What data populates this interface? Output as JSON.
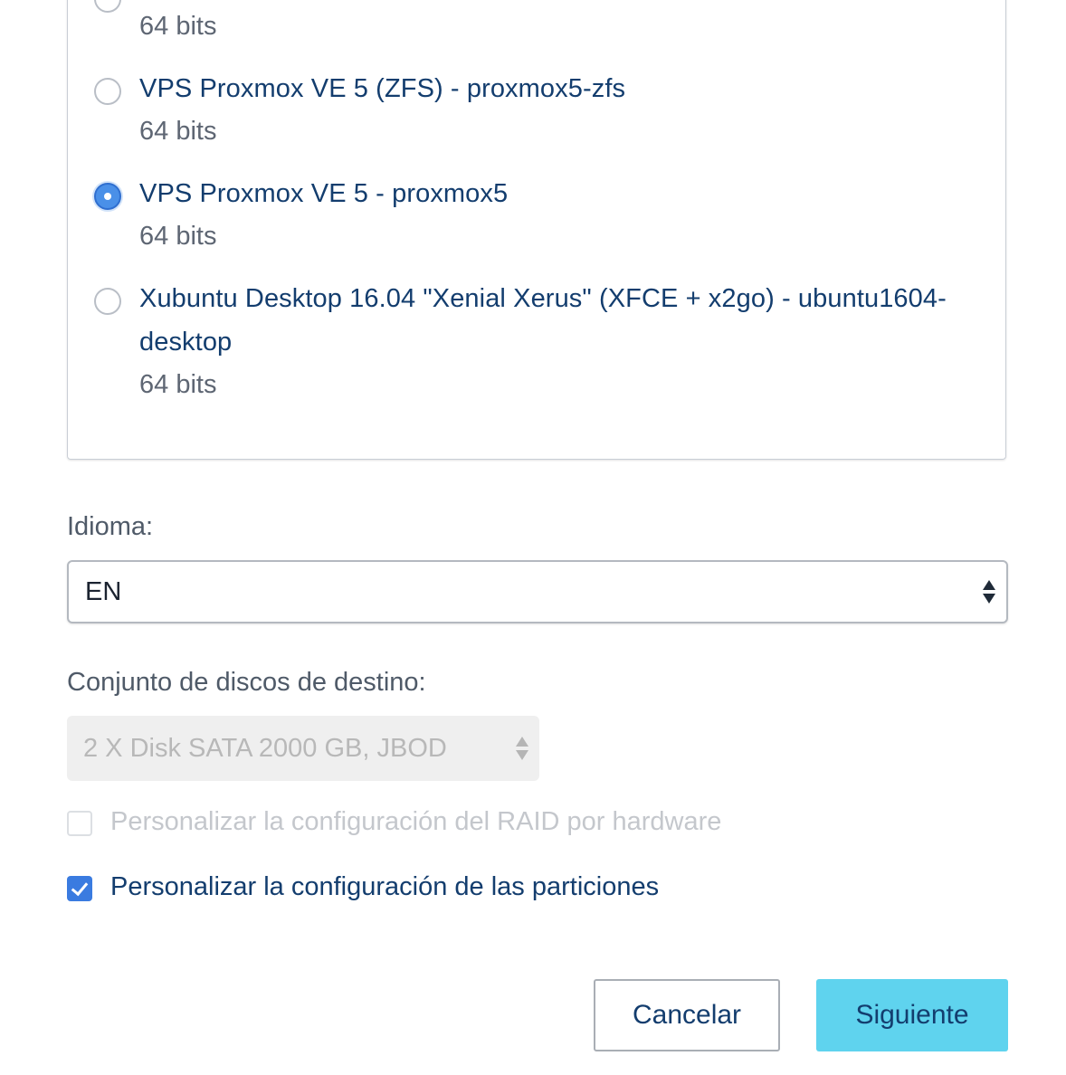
{
  "os_options": [
    {
      "title": "",
      "bits": "64 bits",
      "selected": false
    },
    {
      "title": "VPS Proxmox VE 5 (ZFS) - proxmox5-zfs",
      "bits": "64 bits",
      "selected": false
    },
    {
      "title": "VPS Proxmox VE 5 - proxmox5",
      "bits": "64 bits",
      "selected": true
    },
    {
      "title": "Xubuntu Desktop 16.04 \"Xenial Xerus\" (XFCE + x2go) - ubuntu1604-desktop",
      "bits": "64 bits",
      "selected": false
    }
  ],
  "language": {
    "label": "Idioma:",
    "value": "EN"
  },
  "disk_set": {
    "label": "Conjunto de discos de destino:",
    "value": "2 X Disk SATA 2000 GB, JBOD",
    "disabled": true
  },
  "checkboxes": {
    "raid": {
      "label": "Personalizar la configuración del RAID por hardware",
      "checked": false,
      "disabled": true
    },
    "partitions": {
      "label": "Personalizar la configuración de las particiones",
      "checked": true,
      "disabled": false
    }
  },
  "buttons": {
    "cancel": "Cancelar",
    "next": "Siguiente"
  },
  "colors": {
    "title": "#133d6e",
    "accent": "#4a90e8",
    "next_button": "#5fd3ee",
    "disabled_text": "#b8b8b8"
  }
}
